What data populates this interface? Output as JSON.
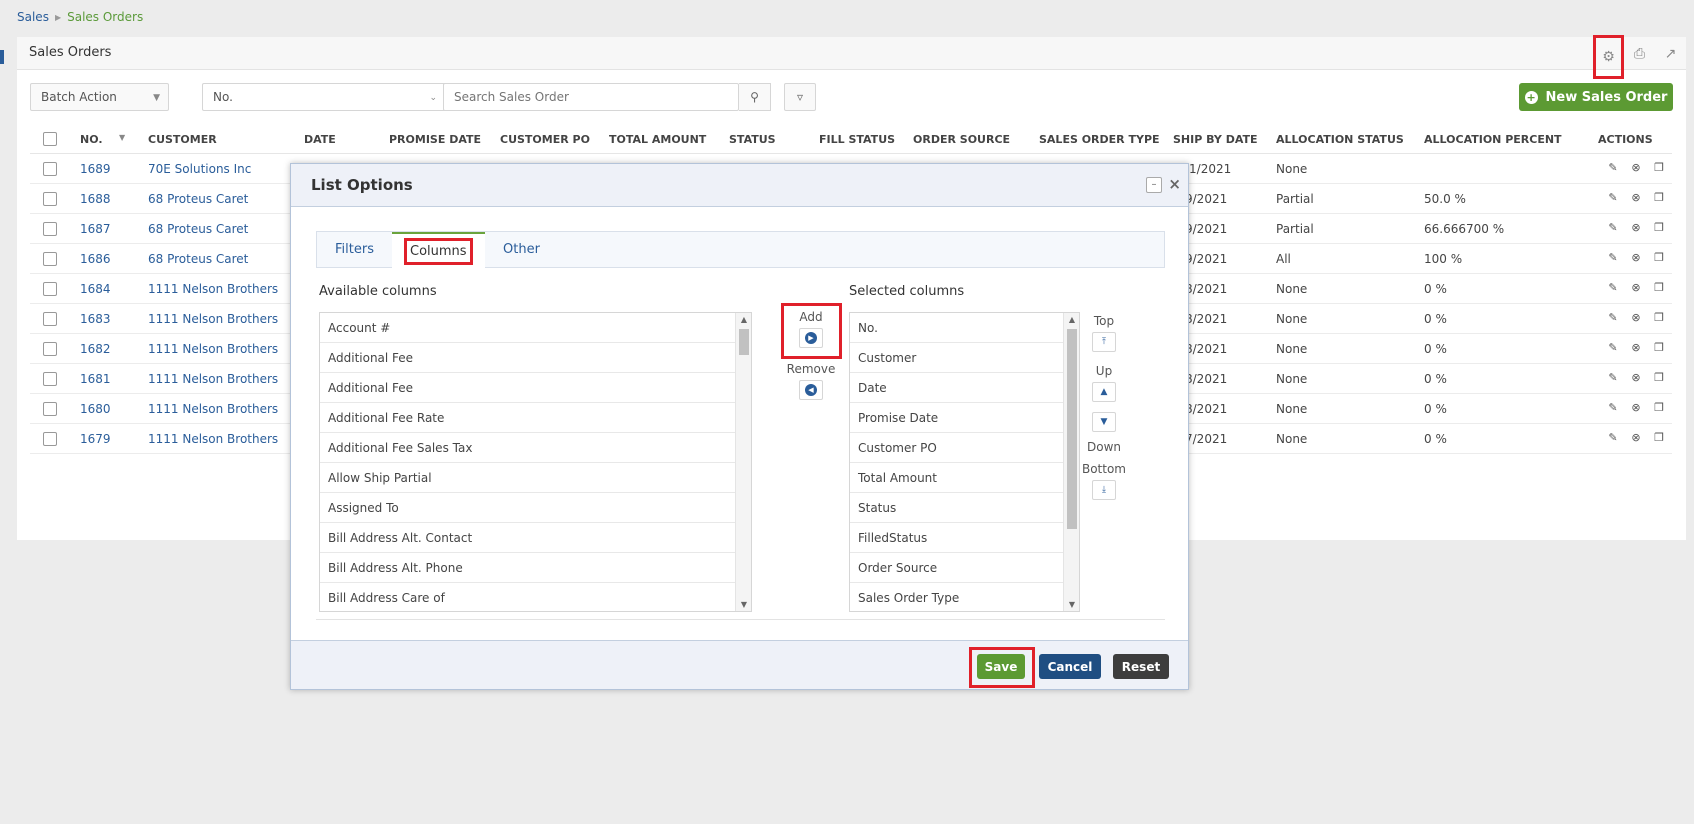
{
  "breadcrumb": {
    "root": "Sales",
    "current": "Sales Orders"
  },
  "panel": {
    "title": "Sales Orders"
  },
  "toolbar": {
    "batch_action": "Batch Action",
    "sort_field": "No.",
    "search_placeholder": "Search Sales Order",
    "new_button": "New Sales Order"
  },
  "table": {
    "headers": [
      "NO.",
      "CUSTOMER",
      "DATE",
      "PROMISE DATE",
      "CUSTOMER PO",
      "TOTAL AMOUNT",
      "STATUS",
      "FILL STATUS",
      "ORDER SOURCE",
      "SALES ORDER TYPE",
      "SHIP BY DATE",
      "ALLOCATION STATUS",
      "ALLOCATION PERCENT",
      "ACTIONS"
    ],
    "rows": [
      {
        "no": "1689",
        "customer": "70E Solutions Inc",
        "ship_by": "/1/2021",
        "alloc_status": "None",
        "alloc_pct": ""
      },
      {
        "no": "1688",
        "customer": "68 Proteus Caret",
        "ship_by": "9/2021",
        "alloc_status": "Partial",
        "alloc_pct": "50.0 %"
      },
      {
        "no": "1687",
        "customer": "68 Proteus Caret",
        "ship_by": "9/2021",
        "alloc_status": "Partial",
        "alloc_pct": "66.666700 %"
      },
      {
        "no": "1686",
        "customer": "68 Proteus Caret",
        "ship_by": "9/2021",
        "alloc_status": "All",
        "alloc_pct": "100 %"
      },
      {
        "no": "1684",
        "customer": "1111 Nelson Brothers",
        "ship_by": "8/2021",
        "alloc_status": "None",
        "alloc_pct": "0 %"
      },
      {
        "no": "1683",
        "customer": "1111 Nelson Brothers",
        "ship_by": "8/2021",
        "alloc_status": "None",
        "alloc_pct": "0 %"
      },
      {
        "no": "1682",
        "customer": "1111 Nelson Brothers",
        "ship_by": "8/2021",
        "alloc_status": "None",
        "alloc_pct": "0 %"
      },
      {
        "no": "1681",
        "customer": "1111 Nelson Brothers",
        "ship_by": "8/2021",
        "alloc_status": "None",
        "alloc_pct": "0 %"
      },
      {
        "no": "1680",
        "customer": "1111 Nelson Brothers",
        "ship_by": "8/2021",
        "alloc_status": "None",
        "alloc_pct": "0 %"
      },
      {
        "no": "1679",
        "customer": "1111 Nelson Brothers",
        "ship_by": "7/2021",
        "alloc_status": "None",
        "alloc_pct": "0 %"
      }
    ]
  },
  "dialog": {
    "title": "List Options",
    "tabs": [
      "Filters",
      "Columns",
      "Other"
    ],
    "available_label": "Available columns",
    "selected_label": "Selected columns",
    "available": [
      "Account #",
      "Additional Fee",
      "Additional Fee",
      "Additional Fee Rate",
      "Additional Fee Sales Tax",
      "Allow Ship Partial",
      "Assigned To",
      "Bill Address Alt. Contact",
      "Bill Address Alt. Phone",
      "Bill Address Care of"
    ],
    "selected": [
      "No.",
      "Customer",
      "Date",
      "Promise Date",
      "Customer PO",
      "Total Amount",
      "Status",
      "FilledStatus",
      "Order Source",
      "Sales Order Type"
    ],
    "add_label": "Add",
    "remove_label": "Remove",
    "top_label": "Top",
    "up_label": "Up",
    "down_label": "Down",
    "bottom_label": "Bottom",
    "save": "Save",
    "cancel": "Cancel",
    "reset": "Reset"
  }
}
